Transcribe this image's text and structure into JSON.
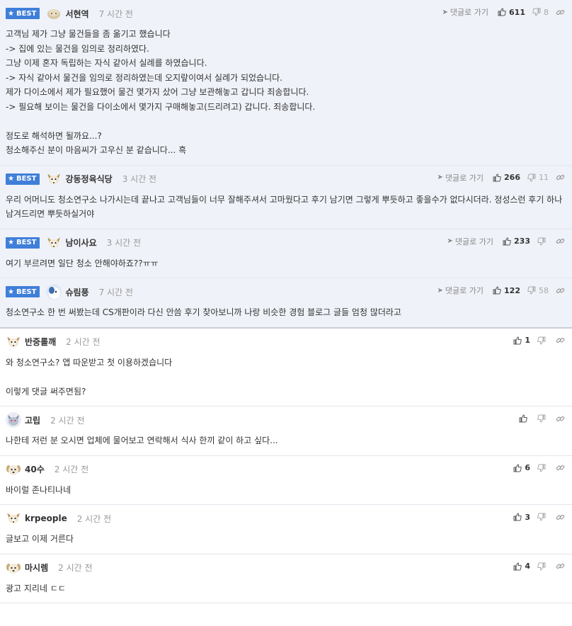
{
  "labels": {
    "best": "BEST",
    "reply": "댓글로 가기"
  },
  "comments": [
    {
      "best": true,
      "nick": "서현역",
      "time": "7 시간 전",
      "likes": "611",
      "dislikes": "8",
      "avatar": "round",
      "text": "고객님 제가 그냥 물건들을 좀 옮기고 했습니다\n-> 집에 있는 물건을 임의로 정리하였다.\n그냥 이제 혼자 독립하는 자식 같아서 실례를 하였습니다.\n-> 자식 같아서 물건을 임의로 정리하였는데 오지랖이여서 실례가 되었습니다.\n제가 다이소에서 제가 필요했어 물건 몇가지 샀어 그냥 보관해놓고 갑니다 죄송합니다.\n-> 필요해 보이는 물건을 다이소에서 몇가지 구매해놓고(드리려고) 갑니다. 죄송합니다.\n\n정도로 해석하면 될까요...?\n청소해주신 분이 마음씨가 고우신 분 같습니다... 흑"
    },
    {
      "best": true,
      "nick": "강동정육식당",
      "time": "3 시간 전",
      "likes": "266",
      "dislikes": "11",
      "avatar": "fox",
      "text": "우리 어머니도 청소연구소 나가시는데 끝나고 고객님들이 너무 잘해주셔서 고마웠다고 후기 남기면 그렇게 뿌듯하고 좋을수가 없다시더라. 정성스런 후기 하나 남겨드리면 뿌듯하실거야"
    },
    {
      "best": true,
      "nick": "남이사요",
      "time": "3 시간 전",
      "likes": "233",
      "dislikes": "",
      "avatar": "fox",
      "text": "여기 부르려면 일단 청소 안해야하죠??ㅠㅠ"
    },
    {
      "best": true,
      "nick": "슈림풍",
      "time": "7 시간 전",
      "likes": "122",
      "dislikes": "58",
      "avatar": "bird",
      "text": "청소연구소 한 번 써봤는데 CS개판이라 다신 안씀 후기 찾아보니까 나랑 비슷한 경험 블로그 글들 엄청 많더라고"
    },
    {
      "best": false,
      "nick": "반중롤깨",
      "time": "2 시간 전",
      "likes": "1",
      "dislikes": "",
      "avatar": "fox",
      "text": "와 청소연구소? 앱 따운받고 첫 이용하겠습니다\n\n이렇게 댓글 써주면됨?"
    },
    {
      "best": false,
      "nick": "고립",
      "time": "2 시간 전",
      "likes": "",
      "dislikes": "",
      "avatar": "wolf",
      "text": "나한테 저런 분 오시면 업체에 물어보고 연락해서 식사 한끼 같이 하고 싶다..."
    },
    {
      "best": false,
      "nick": "40수",
      "time": "2 시간 전",
      "likes": "6",
      "dislikes": "",
      "avatar": "puppy",
      "text": "바이럴 존나티나네"
    },
    {
      "best": false,
      "nick": "krpeople",
      "time": "2 시간 전",
      "likes": "3",
      "dislikes": "",
      "avatar": "fox",
      "text": "글보고 이제 거른다"
    },
    {
      "best": false,
      "nick": "마시렘",
      "time": "2 시간 전",
      "likes": "4",
      "dislikes": "",
      "avatar": "puppy",
      "text": "광고 지리네 ㄷㄷ"
    }
  ]
}
